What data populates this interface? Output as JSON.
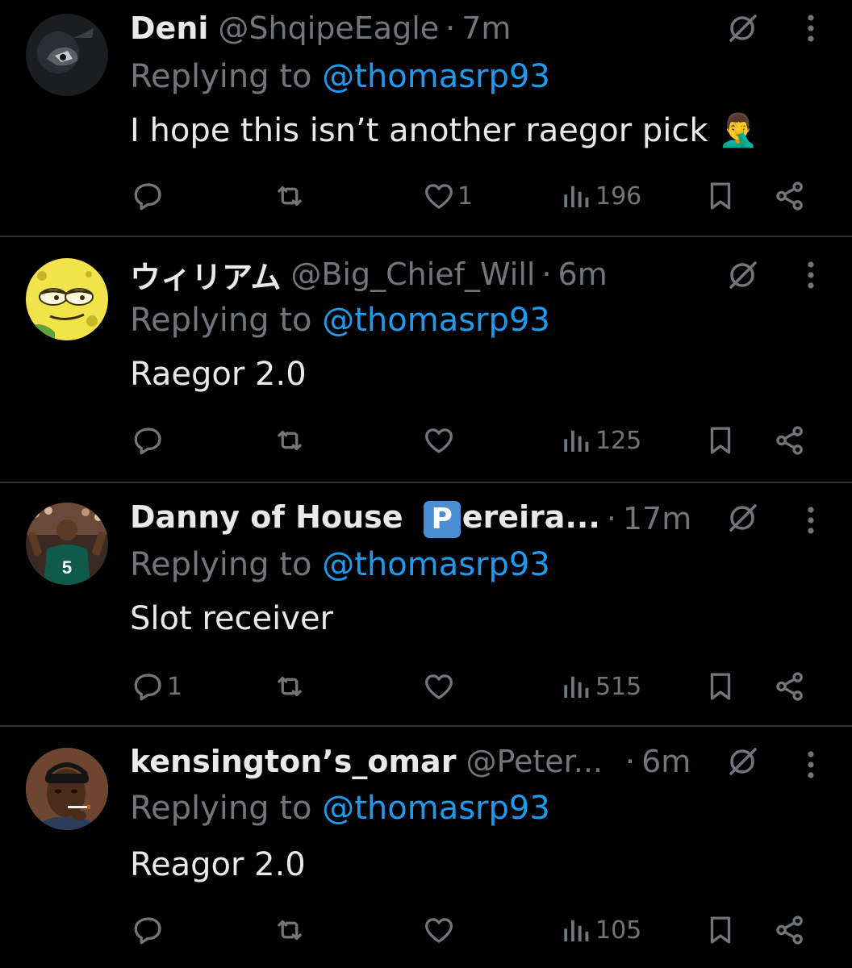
{
  "replying_label": "Replying to",
  "tweets": [
    {
      "name": "Deni",
      "handle": "@ShqipeEagle",
      "dot": "·",
      "time": "7m",
      "replying_to": "@thomasrp93",
      "text": "I hope this isn’t another raegor pick 🤦‍♂️",
      "replies": "",
      "retweets": "",
      "likes": "1",
      "views": "196"
    },
    {
      "name": "ウィリアム",
      "handle": "@Big_Chief_Will",
      "dot": "·",
      "time": "6m",
      "replying_to": "@thomasrp93",
      "text": "Raegor 2.0",
      "replies": "",
      "retweets": "",
      "likes": "",
      "views": "125"
    },
    {
      "name_prefix": "Danny of House ",
      "name_badge": "P",
      "name_suffix": "ereira...",
      "handle": "",
      "dot": "·",
      "time": "17m",
      "replying_to": "@thomasrp93",
      "text": "Slot receiver",
      "replies": "1",
      "retweets": "",
      "likes": "",
      "views": "515"
    },
    {
      "name": "kensington’s_omar",
      "handle": "@Peter...",
      "dot": "·",
      "time": "6m",
      "replying_to": "@thomasrp93",
      "text": "Reagor 2.0",
      "replies": "",
      "retweets": "",
      "likes": "",
      "views": "105"
    }
  ],
  "icons": {
    "reply": "reply-icon",
    "retweet": "retweet-icon",
    "like": "heart-icon",
    "views": "views-icon",
    "bookmark": "bookmark-icon",
    "share": "share-icon",
    "grok": "grok-icon",
    "more": "more-icon"
  },
  "colors": {
    "background": "#000000",
    "text": "#e7e9ea",
    "muted": "#71767b",
    "link": "#1d9bf0",
    "divider": "#2f3336"
  }
}
